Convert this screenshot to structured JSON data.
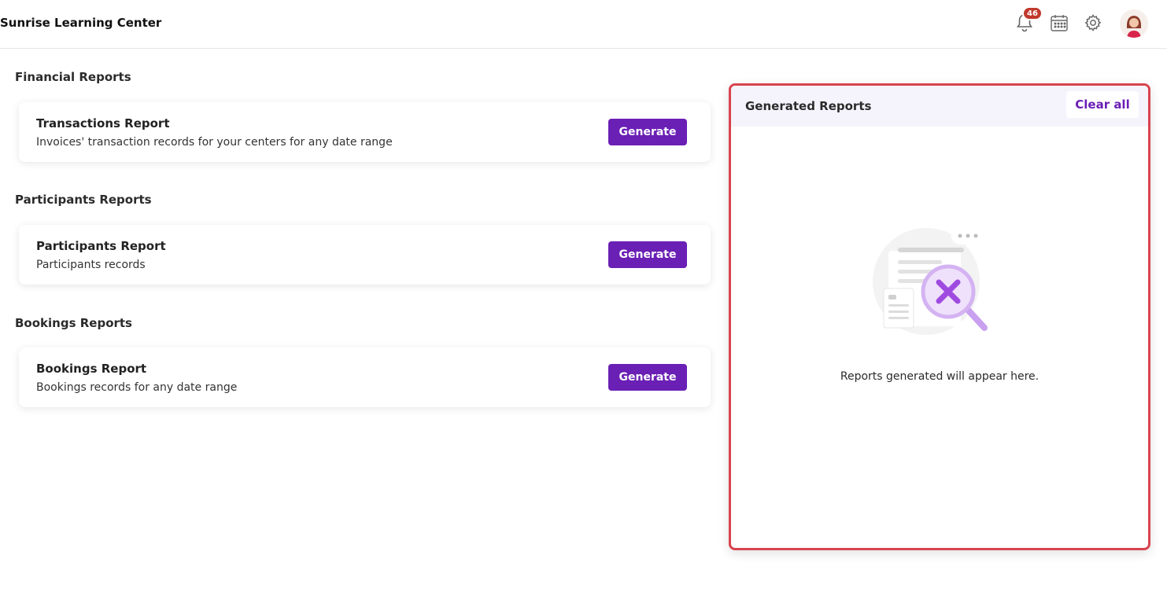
{
  "app": {
    "title": "Sunrise Learning Center"
  },
  "header": {
    "notifications_count": "46",
    "icons": [
      "bell-icon",
      "calendar-icon",
      "gear-icon",
      "avatar"
    ]
  },
  "sections": [
    {
      "title": "Financial Reports",
      "report": {
        "title": "Transactions Report",
        "description": "Invoices' transaction records for your centers for any date range",
        "button": "Generate"
      }
    },
    {
      "title": "Participants Reports",
      "report": {
        "title": "Participants Report",
        "description": "Participants records",
        "button": "Generate"
      }
    },
    {
      "title": "Bookings Reports",
      "report": {
        "title": "Bookings Report",
        "description": "Bookings records for any date range",
        "button": "Generate"
      }
    }
  ],
  "generated_panel": {
    "title": "Generated Reports",
    "clear_label": "Clear all",
    "empty_message": "Reports generated will appear here."
  },
  "colors": {
    "accent": "#6a1fb5",
    "badge": "#c0392b",
    "panel_border": "#d9434f",
    "panel_header_bg": "#f5f4fc"
  }
}
